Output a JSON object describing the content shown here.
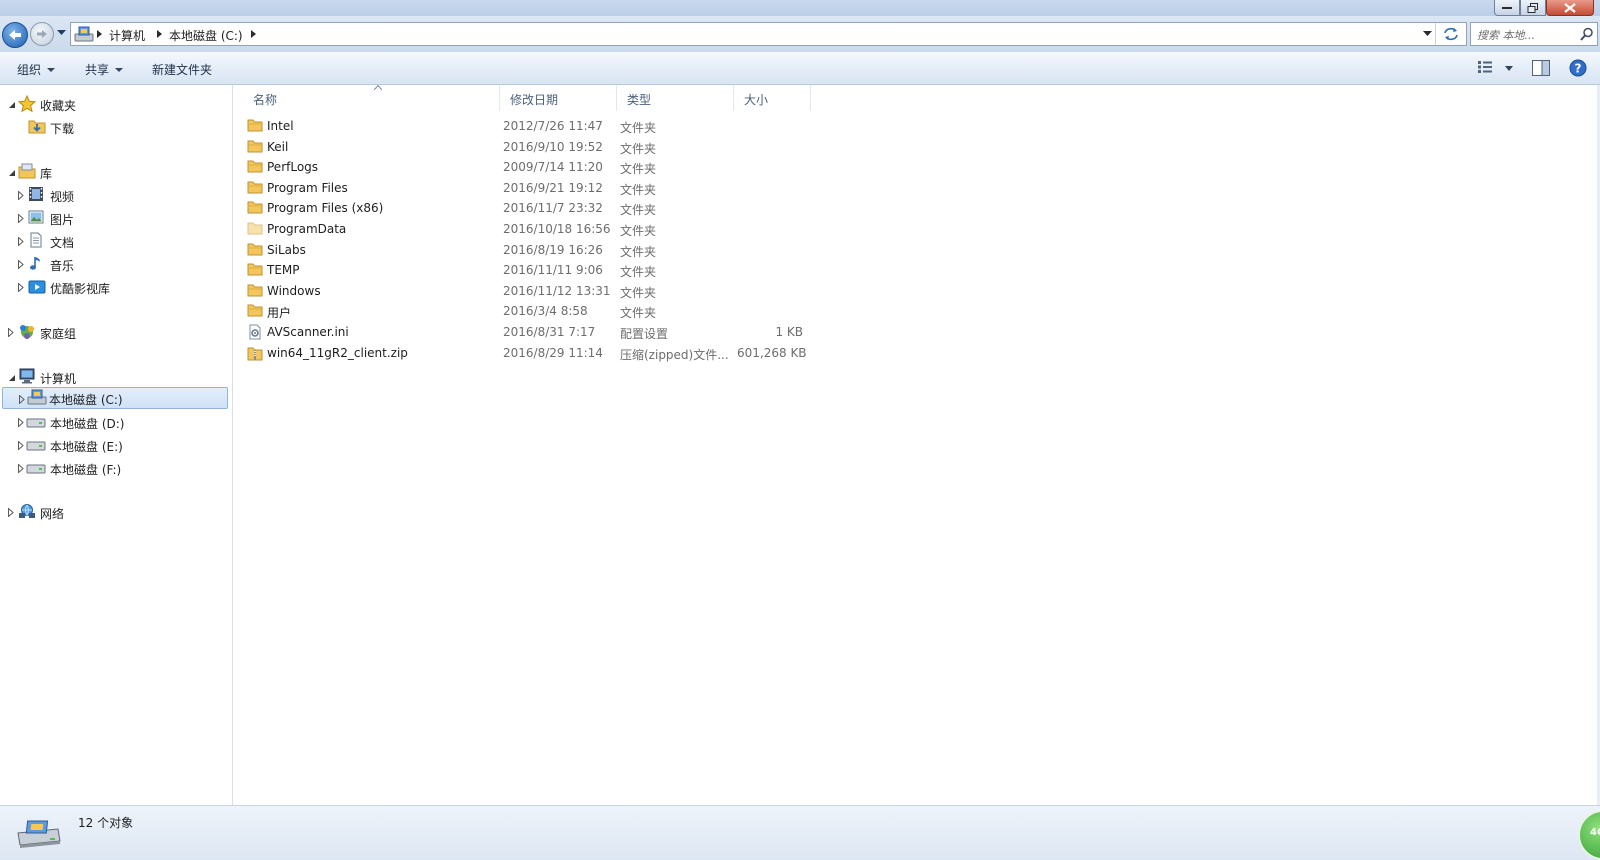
{
  "address": {
    "crumbs": [
      "计算机",
      "本地磁盘 (C:)"
    ]
  },
  "search": {
    "placeholder": "搜索 本地..."
  },
  "toolbar": {
    "organize": "组织",
    "share": "共享",
    "new_folder": "新建文件夹"
  },
  "nav": {
    "favorites": {
      "label": "收藏夹",
      "items": [
        {
          "label": "下载",
          "icon": "download-folder-icon"
        }
      ]
    },
    "libraries": {
      "label": "库",
      "items": [
        {
          "label": "视频",
          "icon": "video-library-icon"
        },
        {
          "label": "图片",
          "icon": "pictures-library-icon"
        },
        {
          "label": "文档",
          "icon": "documents-library-icon"
        },
        {
          "label": "音乐",
          "icon": "music-library-icon"
        },
        {
          "label": "优酷影视库",
          "icon": "youku-library-icon"
        }
      ]
    },
    "homegroup": {
      "label": "家庭组"
    },
    "computer": {
      "label": "计算机",
      "drives": [
        {
          "label": "本地磁盘 (C:)",
          "selected": true
        },
        {
          "label": "本地磁盘 (D:)",
          "selected": false
        },
        {
          "label": "本地磁盘 (E:)",
          "selected": false
        },
        {
          "label": "本地磁盘 (F:)",
          "selected": false
        }
      ]
    },
    "network": {
      "label": "网络"
    }
  },
  "columns": {
    "name": "名称",
    "date": "修改日期",
    "type": "类型",
    "size": "大小"
  },
  "files": [
    {
      "name": "Intel",
      "date": "2012/7/26 11:47",
      "type": "文件夹",
      "size": "",
      "icon": "folder-icon"
    },
    {
      "name": "Keil",
      "date": "2016/9/10 19:52",
      "type": "文件夹",
      "size": "",
      "icon": "folder-icon"
    },
    {
      "name": "PerfLogs",
      "date": "2009/7/14 11:20",
      "type": "文件夹",
      "size": "",
      "icon": "folder-icon"
    },
    {
      "name": "Program Files",
      "date": "2016/9/21 19:12",
      "type": "文件夹",
      "size": "",
      "icon": "folder-icon"
    },
    {
      "name": "Program Files (x86)",
      "date": "2016/11/7 23:32",
      "type": "文件夹",
      "size": "",
      "icon": "folder-icon"
    },
    {
      "name": "ProgramData",
      "date": "2016/10/18 16:56",
      "type": "文件夹",
      "size": "",
      "icon": "folder-hidden-icon"
    },
    {
      "name": "SiLabs",
      "date": "2016/8/19 16:26",
      "type": "文件夹",
      "size": "",
      "icon": "folder-icon"
    },
    {
      "name": "TEMP",
      "date": "2016/11/11 9:06",
      "type": "文件夹",
      "size": "",
      "icon": "folder-icon"
    },
    {
      "name": "Windows",
      "date": "2016/11/12 13:31",
      "type": "文件夹",
      "size": "",
      "icon": "folder-icon"
    },
    {
      "name": "用户",
      "date": "2016/3/4 8:58",
      "type": "文件夹",
      "size": "",
      "icon": "folder-icon"
    },
    {
      "name": "AVScanner.ini",
      "date": "2016/8/31 7:17",
      "type": "配置设置",
      "size": "1 KB",
      "icon": "settings-file-icon"
    },
    {
      "name": "win64_11gR2_client.zip",
      "date": "2016/8/29 11:14",
      "type": "压缩(zipped)文件...",
      "size": "601,268 KB",
      "icon": "zip-file-icon"
    }
  ],
  "status": {
    "count": "12 个对象"
  },
  "colors": {
    "accent": "#1d5fb3",
    "selection": "#cfe2f7",
    "folder": "#f2c65a"
  }
}
